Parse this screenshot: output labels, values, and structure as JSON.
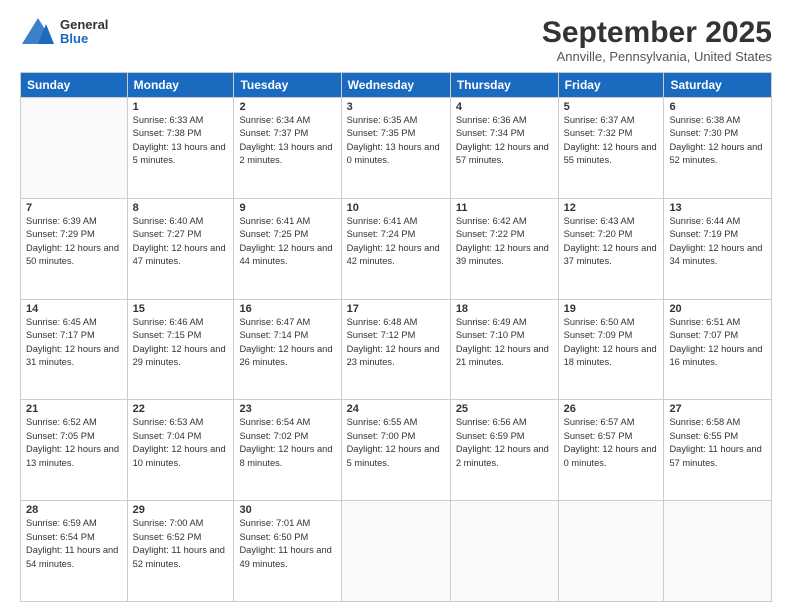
{
  "logo": {
    "general": "General",
    "blue": "Blue"
  },
  "title": "September 2025",
  "location": "Annville, Pennsylvania, United States",
  "days_of_week": [
    "Sunday",
    "Monday",
    "Tuesday",
    "Wednesday",
    "Thursday",
    "Friday",
    "Saturday"
  ],
  "weeks": [
    [
      {
        "day": "",
        "sunrise": "",
        "sunset": "",
        "daylight": ""
      },
      {
        "day": "1",
        "sunrise": "Sunrise: 6:33 AM",
        "sunset": "Sunset: 7:38 PM",
        "daylight": "Daylight: 13 hours and 5 minutes."
      },
      {
        "day": "2",
        "sunrise": "Sunrise: 6:34 AM",
        "sunset": "Sunset: 7:37 PM",
        "daylight": "Daylight: 13 hours and 2 minutes."
      },
      {
        "day": "3",
        "sunrise": "Sunrise: 6:35 AM",
        "sunset": "Sunset: 7:35 PM",
        "daylight": "Daylight: 13 hours and 0 minutes."
      },
      {
        "day": "4",
        "sunrise": "Sunrise: 6:36 AM",
        "sunset": "Sunset: 7:34 PM",
        "daylight": "Daylight: 12 hours and 57 minutes."
      },
      {
        "day": "5",
        "sunrise": "Sunrise: 6:37 AM",
        "sunset": "Sunset: 7:32 PM",
        "daylight": "Daylight: 12 hours and 55 minutes."
      },
      {
        "day": "6",
        "sunrise": "Sunrise: 6:38 AM",
        "sunset": "Sunset: 7:30 PM",
        "daylight": "Daylight: 12 hours and 52 minutes."
      }
    ],
    [
      {
        "day": "7",
        "sunrise": "Sunrise: 6:39 AM",
        "sunset": "Sunset: 7:29 PM",
        "daylight": "Daylight: 12 hours and 50 minutes."
      },
      {
        "day": "8",
        "sunrise": "Sunrise: 6:40 AM",
        "sunset": "Sunset: 7:27 PM",
        "daylight": "Daylight: 12 hours and 47 minutes."
      },
      {
        "day": "9",
        "sunrise": "Sunrise: 6:41 AM",
        "sunset": "Sunset: 7:25 PM",
        "daylight": "Daylight: 12 hours and 44 minutes."
      },
      {
        "day": "10",
        "sunrise": "Sunrise: 6:41 AM",
        "sunset": "Sunset: 7:24 PM",
        "daylight": "Daylight: 12 hours and 42 minutes."
      },
      {
        "day": "11",
        "sunrise": "Sunrise: 6:42 AM",
        "sunset": "Sunset: 7:22 PM",
        "daylight": "Daylight: 12 hours and 39 minutes."
      },
      {
        "day": "12",
        "sunrise": "Sunrise: 6:43 AM",
        "sunset": "Sunset: 7:20 PM",
        "daylight": "Daylight: 12 hours and 37 minutes."
      },
      {
        "day": "13",
        "sunrise": "Sunrise: 6:44 AM",
        "sunset": "Sunset: 7:19 PM",
        "daylight": "Daylight: 12 hours and 34 minutes."
      }
    ],
    [
      {
        "day": "14",
        "sunrise": "Sunrise: 6:45 AM",
        "sunset": "Sunset: 7:17 PM",
        "daylight": "Daylight: 12 hours and 31 minutes."
      },
      {
        "day": "15",
        "sunrise": "Sunrise: 6:46 AM",
        "sunset": "Sunset: 7:15 PM",
        "daylight": "Daylight: 12 hours and 29 minutes."
      },
      {
        "day": "16",
        "sunrise": "Sunrise: 6:47 AM",
        "sunset": "Sunset: 7:14 PM",
        "daylight": "Daylight: 12 hours and 26 minutes."
      },
      {
        "day": "17",
        "sunrise": "Sunrise: 6:48 AM",
        "sunset": "Sunset: 7:12 PM",
        "daylight": "Daylight: 12 hours and 23 minutes."
      },
      {
        "day": "18",
        "sunrise": "Sunrise: 6:49 AM",
        "sunset": "Sunset: 7:10 PM",
        "daylight": "Daylight: 12 hours and 21 minutes."
      },
      {
        "day": "19",
        "sunrise": "Sunrise: 6:50 AM",
        "sunset": "Sunset: 7:09 PM",
        "daylight": "Daylight: 12 hours and 18 minutes."
      },
      {
        "day": "20",
        "sunrise": "Sunrise: 6:51 AM",
        "sunset": "Sunset: 7:07 PM",
        "daylight": "Daylight: 12 hours and 16 minutes."
      }
    ],
    [
      {
        "day": "21",
        "sunrise": "Sunrise: 6:52 AM",
        "sunset": "Sunset: 7:05 PM",
        "daylight": "Daylight: 12 hours and 13 minutes."
      },
      {
        "day": "22",
        "sunrise": "Sunrise: 6:53 AM",
        "sunset": "Sunset: 7:04 PM",
        "daylight": "Daylight: 12 hours and 10 minutes."
      },
      {
        "day": "23",
        "sunrise": "Sunrise: 6:54 AM",
        "sunset": "Sunset: 7:02 PM",
        "daylight": "Daylight: 12 hours and 8 minutes."
      },
      {
        "day": "24",
        "sunrise": "Sunrise: 6:55 AM",
        "sunset": "Sunset: 7:00 PM",
        "daylight": "Daylight: 12 hours and 5 minutes."
      },
      {
        "day": "25",
        "sunrise": "Sunrise: 6:56 AM",
        "sunset": "Sunset: 6:59 PM",
        "daylight": "Daylight: 12 hours and 2 minutes."
      },
      {
        "day": "26",
        "sunrise": "Sunrise: 6:57 AM",
        "sunset": "Sunset: 6:57 PM",
        "daylight": "Daylight: 12 hours and 0 minutes."
      },
      {
        "day": "27",
        "sunrise": "Sunrise: 6:58 AM",
        "sunset": "Sunset: 6:55 PM",
        "daylight": "Daylight: 11 hours and 57 minutes."
      }
    ],
    [
      {
        "day": "28",
        "sunrise": "Sunrise: 6:59 AM",
        "sunset": "Sunset: 6:54 PM",
        "daylight": "Daylight: 11 hours and 54 minutes."
      },
      {
        "day": "29",
        "sunrise": "Sunrise: 7:00 AM",
        "sunset": "Sunset: 6:52 PM",
        "daylight": "Daylight: 11 hours and 52 minutes."
      },
      {
        "day": "30",
        "sunrise": "Sunrise: 7:01 AM",
        "sunset": "Sunset: 6:50 PM",
        "daylight": "Daylight: 11 hours and 49 minutes."
      },
      {
        "day": "",
        "sunrise": "",
        "sunset": "",
        "daylight": ""
      },
      {
        "day": "",
        "sunrise": "",
        "sunset": "",
        "daylight": ""
      },
      {
        "day": "",
        "sunrise": "",
        "sunset": "",
        "daylight": ""
      },
      {
        "day": "",
        "sunrise": "",
        "sunset": "",
        "daylight": ""
      }
    ]
  ]
}
